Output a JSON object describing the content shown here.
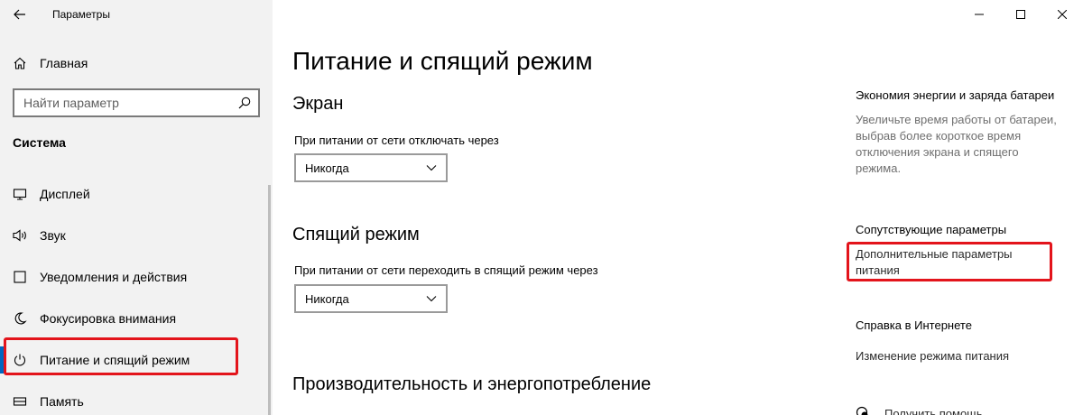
{
  "window": {
    "app_title": "Параметры"
  },
  "sidebar": {
    "home_label": "Главная",
    "search": {
      "placeholder": "Найти параметр"
    },
    "section_header": "Система",
    "items": [
      {
        "label": "Дисплей",
        "icon": "monitor-icon"
      },
      {
        "label": "Звук",
        "icon": "speaker-icon"
      },
      {
        "label": "Уведомления и действия",
        "icon": "notification-icon"
      },
      {
        "label": "Фокусировка внимания",
        "icon": "moon-icon"
      },
      {
        "label": "Питание и спящий режим",
        "icon": "power-icon",
        "active": true
      },
      {
        "label": "Память",
        "icon": "storage-icon"
      }
    ]
  },
  "main": {
    "title": "Питание и спящий режим",
    "screen": {
      "heading": "Экран",
      "label": "При питании от сети отключать через",
      "value": "Никогда"
    },
    "sleep": {
      "heading": "Спящий режим",
      "label": "При питании от сети переходить в спящий режим через",
      "value": "Никогда"
    },
    "performance_heading": "Производительность и энергопотребление"
  },
  "right": {
    "battery": {
      "heading": "Экономия энергии и заряда батареи",
      "desc": "Увеличьте время работы от батареи, выбрав более короткое время отключения экрана и спящего режима."
    },
    "related": {
      "heading": "Сопутствующие параметры",
      "link": "Дополнительные параметры питания"
    },
    "help": {
      "heading": "Справка в Интернете",
      "link": "Изменение режима питания"
    },
    "get_help": "Получить помощь"
  },
  "colors": {
    "highlight": "#e3141b",
    "accent": "#0067c0",
    "sidebar_bg": "#f2f2f2"
  }
}
